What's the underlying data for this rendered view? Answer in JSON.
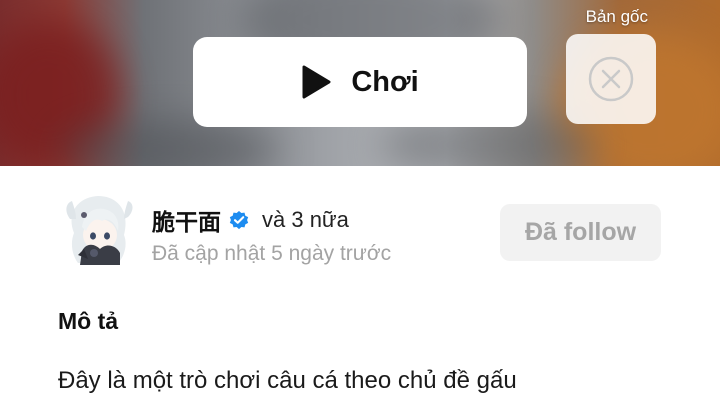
{
  "hero": {
    "version_label": "Bản gốc",
    "play_label": "Chơi",
    "play_icon": "play-icon",
    "close_icon": "close-circle-icon"
  },
  "author": {
    "name": "脆干面",
    "verified_icon": "verified-check-icon",
    "and_more": "và 3 nữa",
    "updated": "Đã cập nhật 5 ngày trước",
    "follow_label": "Đã follow"
  },
  "description": {
    "heading": "Mô tả",
    "text": "Đây là một trò chơi câu cá theo chủ đề gấu"
  },
  "colors": {
    "verified": "#1d8cf0",
    "follow_bg": "#f2f2f2",
    "muted_text": "#a3a3a3"
  }
}
